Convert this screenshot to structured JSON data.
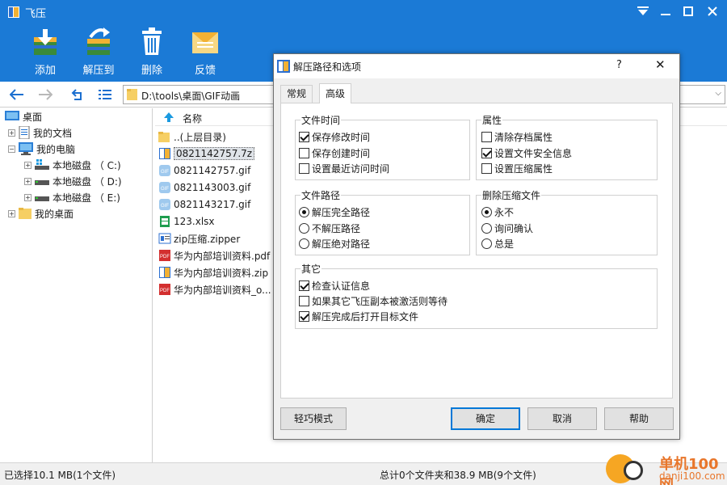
{
  "app": {
    "title": "飞压",
    "accent": "#1b7ad6"
  },
  "toolbar": {
    "add": "添加",
    "extract_to": "解压到",
    "delete": "删除",
    "feedback": "反馈"
  },
  "address": {
    "path": "D:\\tools\\桌面\\GIF动画"
  },
  "tree": {
    "desktop": "桌面",
    "my_docs": "我的文档",
    "my_computer": "我的电脑",
    "drive_c": "本地磁盘 （ C:)",
    "drive_d": "本地磁盘 （ D:)",
    "drive_e": "本地磁盘 （ E:)",
    "my_desktop": "我的桌面"
  },
  "filelist": {
    "col_name": "名称",
    "files": [
      {
        "name": "..(上层目录)",
        "icon": "folder-icon"
      },
      {
        "name": "0821142757.7z",
        "icon": "archive-icon"
      },
      {
        "name": "0821142757.gif",
        "icon": "gif-icon"
      },
      {
        "name": "0821143003.gif",
        "icon": "gif-icon"
      },
      {
        "name": "0821143217.gif",
        "icon": "gif-icon"
      },
      {
        "name": "123.xlsx",
        "icon": "excel-icon"
      },
      {
        "name": "zip压缩.zipper",
        "icon": "zipper-icon"
      },
      {
        "name": "华为内部培训资料.pdf",
        "icon": "pdf-icon"
      },
      {
        "name": "华为内部培训资料.zip",
        "icon": "archive-icon"
      },
      {
        "name": "华为内部培训资料_o...",
        "icon": "pdf-icon"
      }
    ]
  },
  "status": {
    "left": "已选择10.1 MB(1个文件)",
    "middle": "总计0个文件夹和38.9 MB(9个文件)"
  },
  "watermark": {
    "line1": "单机100网",
    "line2": "danji100.com"
  },
  "dialog": {
    "title": "解压路径和选项",
    "help_glyph": "?",
    "close_glyph": "✕",
    "tabs": {
      "general": "常规",
      "advanced": "高级"
    },
    "file_time": {
      "title": "文件时间",
      "keep_modified": "保存修改时间",
      "keep_created": "保存创建时间",
      "set_access": "设置最近访问时间"
    },
    "attributes": {
      "title": "属性",
      "clear_archive": "清除存档属性",
      "set_security": "设置文件安全信息",
      "set_compress": "设置压缩属性"
    },
    "file_path": {
      "title": "文件路径",
      "full": "解压完全路径",
      "none": "不解压路径",
      "absolute": "解压绝对路径"
    },
    "delete_archive": {
      "title": "删除压缩文件",
      "never": "永不",
      "ask": "询问确认",
      "always": "总是"
    },
    "other": {
      "title": "其它",
      "check_auth": "检查认证信息",
      "wait_if_active": "如果其它飞压副本被激活则等待",
      "open_after": "解压完成后打开目标文件"
    },
    "buttons": {
      "light_mode": "轻巧模式",
      "ok": "确定",
      "cancel": "取消",
      "help": "帮助"
    }
  }
}
